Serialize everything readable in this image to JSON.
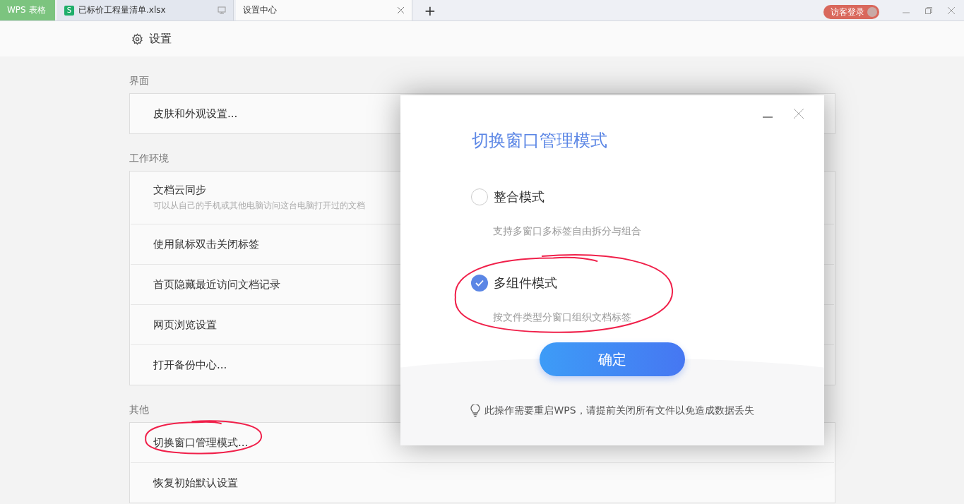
{
  "tabs": [
    {
      "kind": "app",
      "label": "WPS 表格",
      "selected": false
    },
    {
      "kind": "file",
      "icon": "S",
      "label": "已标价工程量清单.xlsx",
      "selected": false
    },
    {
      "kind": "page",
      "label": "设置中心",
      "selected": true
    }
  ],
  "new_tab": "+",
  "login": "访客登录",
  "header": {
    "title": "设置"
  },
  "sections": [
    {
      "title": "界面",
      "items": [
        {
          "label": "皮肤和外观设置...",
          "circled": false
        }
      ]
    },
    {
      "title": "工作环境",
      "items": [
        {
          "label": "文档云同步",
          "description": "可以从自己的手机或其他电脑访问这台电脑打开过的文档",
          "circled": false
        },
        {
          "label": "使用鼠标双击关闭标签",
          "circled": false
        },
        {
          "label": "首页隐藏最近访问文档记录",
          "circled": false
        },
        {
          "label": "网页浏览设置",
          "circled": false
        },
        {
          "label": "打开备份中心...",
          "circled": false
        }
      ]
    },
    {
      "title": "其他",
      "items": [
        {
          "label": "切换窗口管理模式...",
          "circled": true
        },
        {
          "label": "恢复初始默认设置",
          "circled": false
        }
      ]
    }
  ],
  "dialog": {
    "title": "切换窗口管理模式",
    "options": [
      {
        "label": "整合模式",
        "description": "支持多窗口多标签自由拆分与组合",
        "selected": false,
        "circled": false
      },
      {
        "label": "多组件模式",
        "description": "按文件类型分窗口组织文档标签",
        "selected": true,
        "circled": true
      }
    ],
    "confirm": "确定",
    "note": "此操作需要重启WPS，请提前关闭所有文件以免造成数据丢失"
  }
}
